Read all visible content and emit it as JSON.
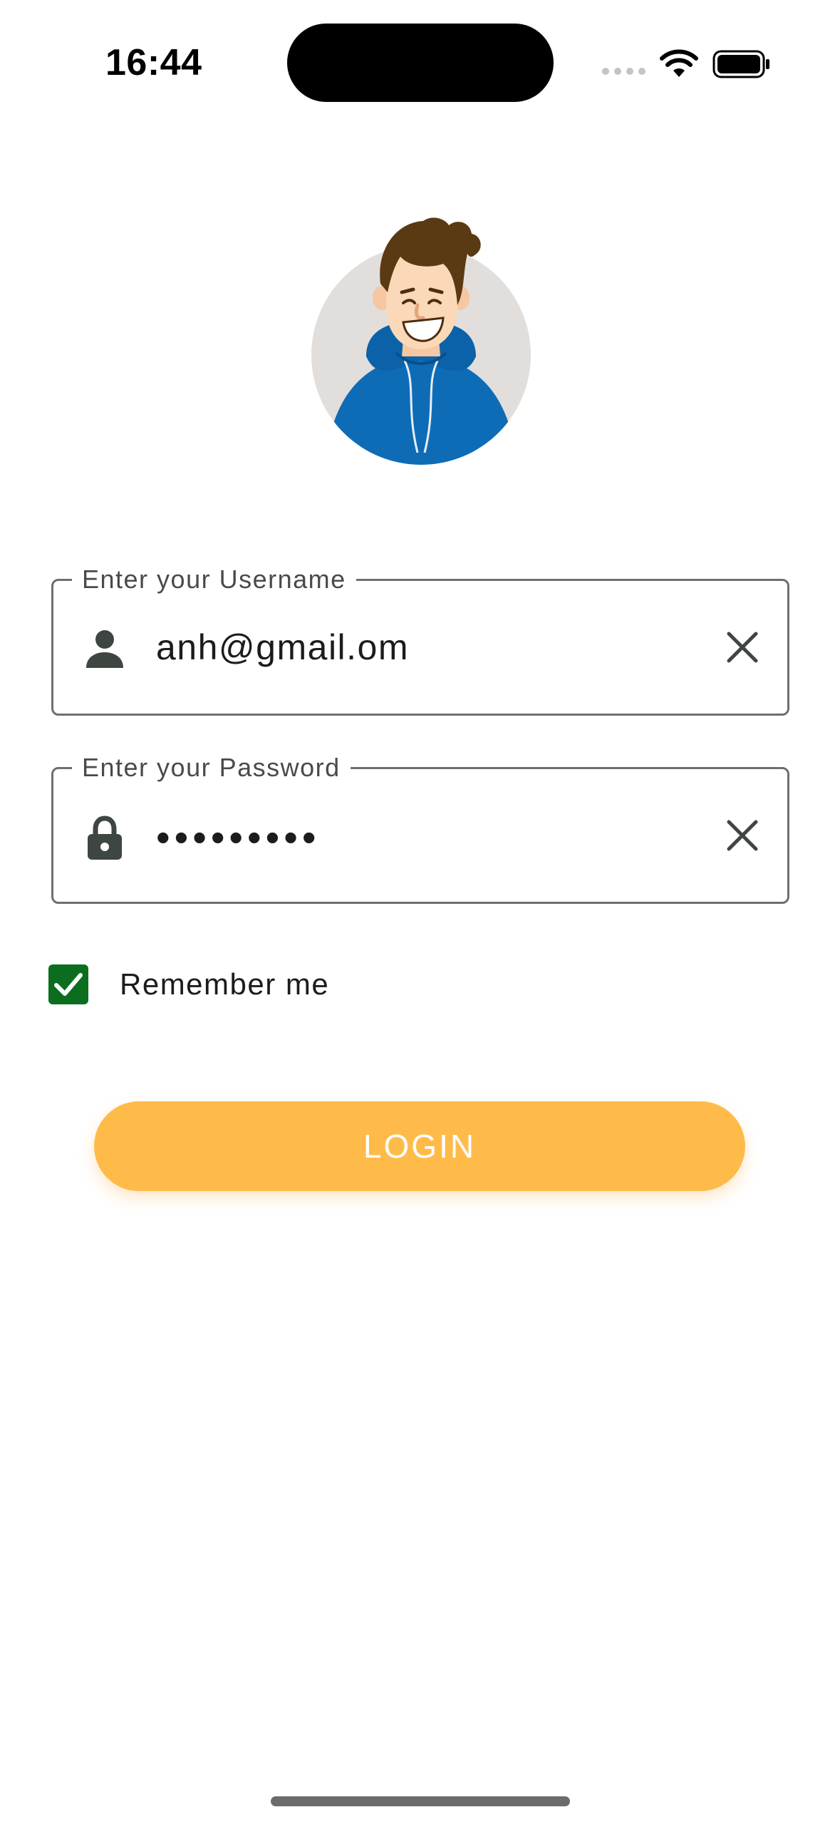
{
  "status_bar": {
    "time": "16:44",
    "icons": [
      "signal-icon",
      "wifi-icon",
      "battery-icon"
    ]
  },
  "avatar": {
    "icon": "avatar-illustration"
  },
  "username": {
    "label": "Enter your Username",
    "value": "anh@gmail.om",
    "icon": "person-icon",
    "clear_icon": "close-icon"
  },
  "password": {
    "label": "Enter your Password",
    "value": "•••••••••",
    "icon": "lock-icon",
    "clear_icon": "close-icon"
  },
  "remember": {
    "label": "Remember me",
    "checked": true
  },
  "login": {
    "label": "LOGIN"
  },
  "colors": {
    "accent": "#ffbb4a",
    "checkbox": "#0b6e1f",
    "border": "#6f6f6f"
  }
}
